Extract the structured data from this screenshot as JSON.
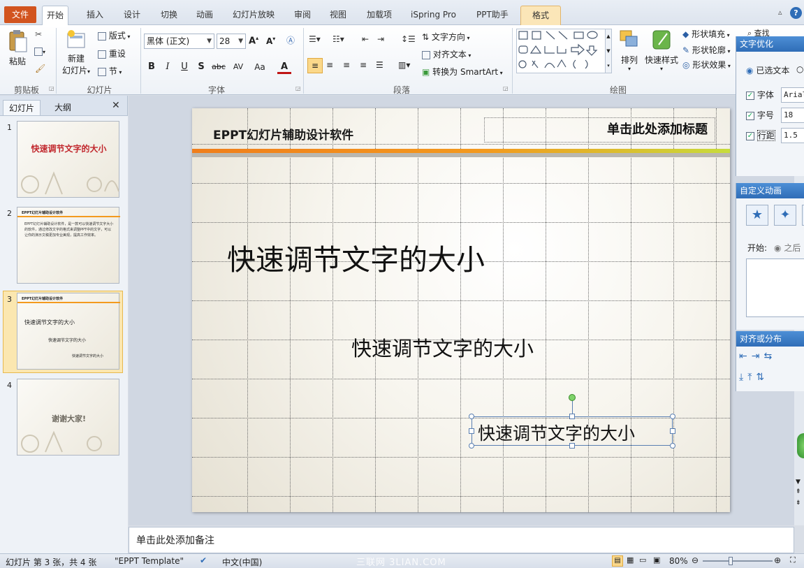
{
  "tabs": {
    "file": "文件",
    "items": [
      "开始",
      "插入",
      "设计",
      "切换",
      "动画",
      "幻灯片放映",
      "审阅",
      "视图",
      "加载项",
      "iSpring Pro",
      "PPT助手"
    ],
    "context": "格式"
  },
  "ribbon": {
    "clipboard": {
      "paste": "粘贴",
      "label": "剪贴板"
    },
    "slides": {
      "new_slide": "新建",
      "new_slide2": "幻灯片",
      "layout": "版式",
      "reset": "重设",
      "section": "节",
      "label": "幻灯片"
    },
    "font": {
      "font_name": "黑体 (正文)",
      "font_size": "28",
      "label": "字体",
      "buttons": {
        "bold": "B",
        "italic": "I",
        "underline": "U",
        "shadow": "S",
        "strike": "abc",
        "spacing": "AV",
        "case": "Aa",
        "color": "A"
      }
    },
    "paragraph": {
      "text_direction": "文字方向",
      "align_text": "对齐文本",
      "smartart": "转换为 SmartArt",
      "label": "段落"
    },
    "drawing": {
      "arrange": "排列",
      "quick_styles": "快速样式",
      "shape_fill": "形状填充",
      "shape_outline": "形状轮廓",
      "shape_effects": "形状效果",
      "find": "查找",
      "label": "绘图"
    }
  },
  "left_pane": {
    "tab_slides": "幻灯片",
    "tab_outline": "大纲",
    "thumbs": [
      {
        "num": "1",
        "title": "快速调节文字的大小"
      },
      {
        "num": "2",
        "title": "EPPT幻灯片辅助设计软件",
        "body": "EPPT幻灯片辅助设计软件，是一款可以快速调节文字大小的软件，通过修改文字的格式来调整PPT中的文字，可以让你的演示文稿更加专业美观，提高工作效率。"
      },
      {
        "num": "3",
        "header": "EPPT幻灯片辅助设计软件",
        "l1": "快速调节文字的大小",
        "l2": "快速调节文字的大小",
        "l3": "快速调节文字的大小"
      },
      {
        "num": "4",
        "title": "谢谢大家!"
      }
    ]
  },
  "slide": {
    "header_title": "EPPT幻灯片辅助设计软件",
    "title_placeholder": "单击此处添加标题",
    "text_large": "快速调节文字的大小",
    "text_medium": "快速调节文字的大小",
    "text_small": "快速调节文字的大小"
  },
  "notes_placeholder": "单击此处添加备注",
  "right_panels": {
    "text_opt": {
      "title": "文字优化",
      "selected_text": "已选文本",
      "font_label": "字体",
      "font_value": "Arial",
      "size_label": "字号",
      "size_value": "18",
      "spacing_label": "行距",
      "spacing_value": "1.5"
    },
    "anim": {
      "title": "自定义动画",
      "start_label": "开始:",
      "after": "之后"
    },
    "align": {
      "title": "对齐或分布"
    }
  },
  "statusbar": {
    "slide_info": "幻灯片 第 3 张，共 4 张",
    "template": "\"EPPT Template\"",
    "language": "中文(中国)",
    "zoom": "80%"
  },
  "watermark": "三联网 3LIAN.COM",
  "colors": {
    "accent_orange": "#f39a1e",
    "accent_green": "#c7dc3c",
    "file_tab": "#d2541f",
    "panel_title": "#2f6db7"
  }
}
